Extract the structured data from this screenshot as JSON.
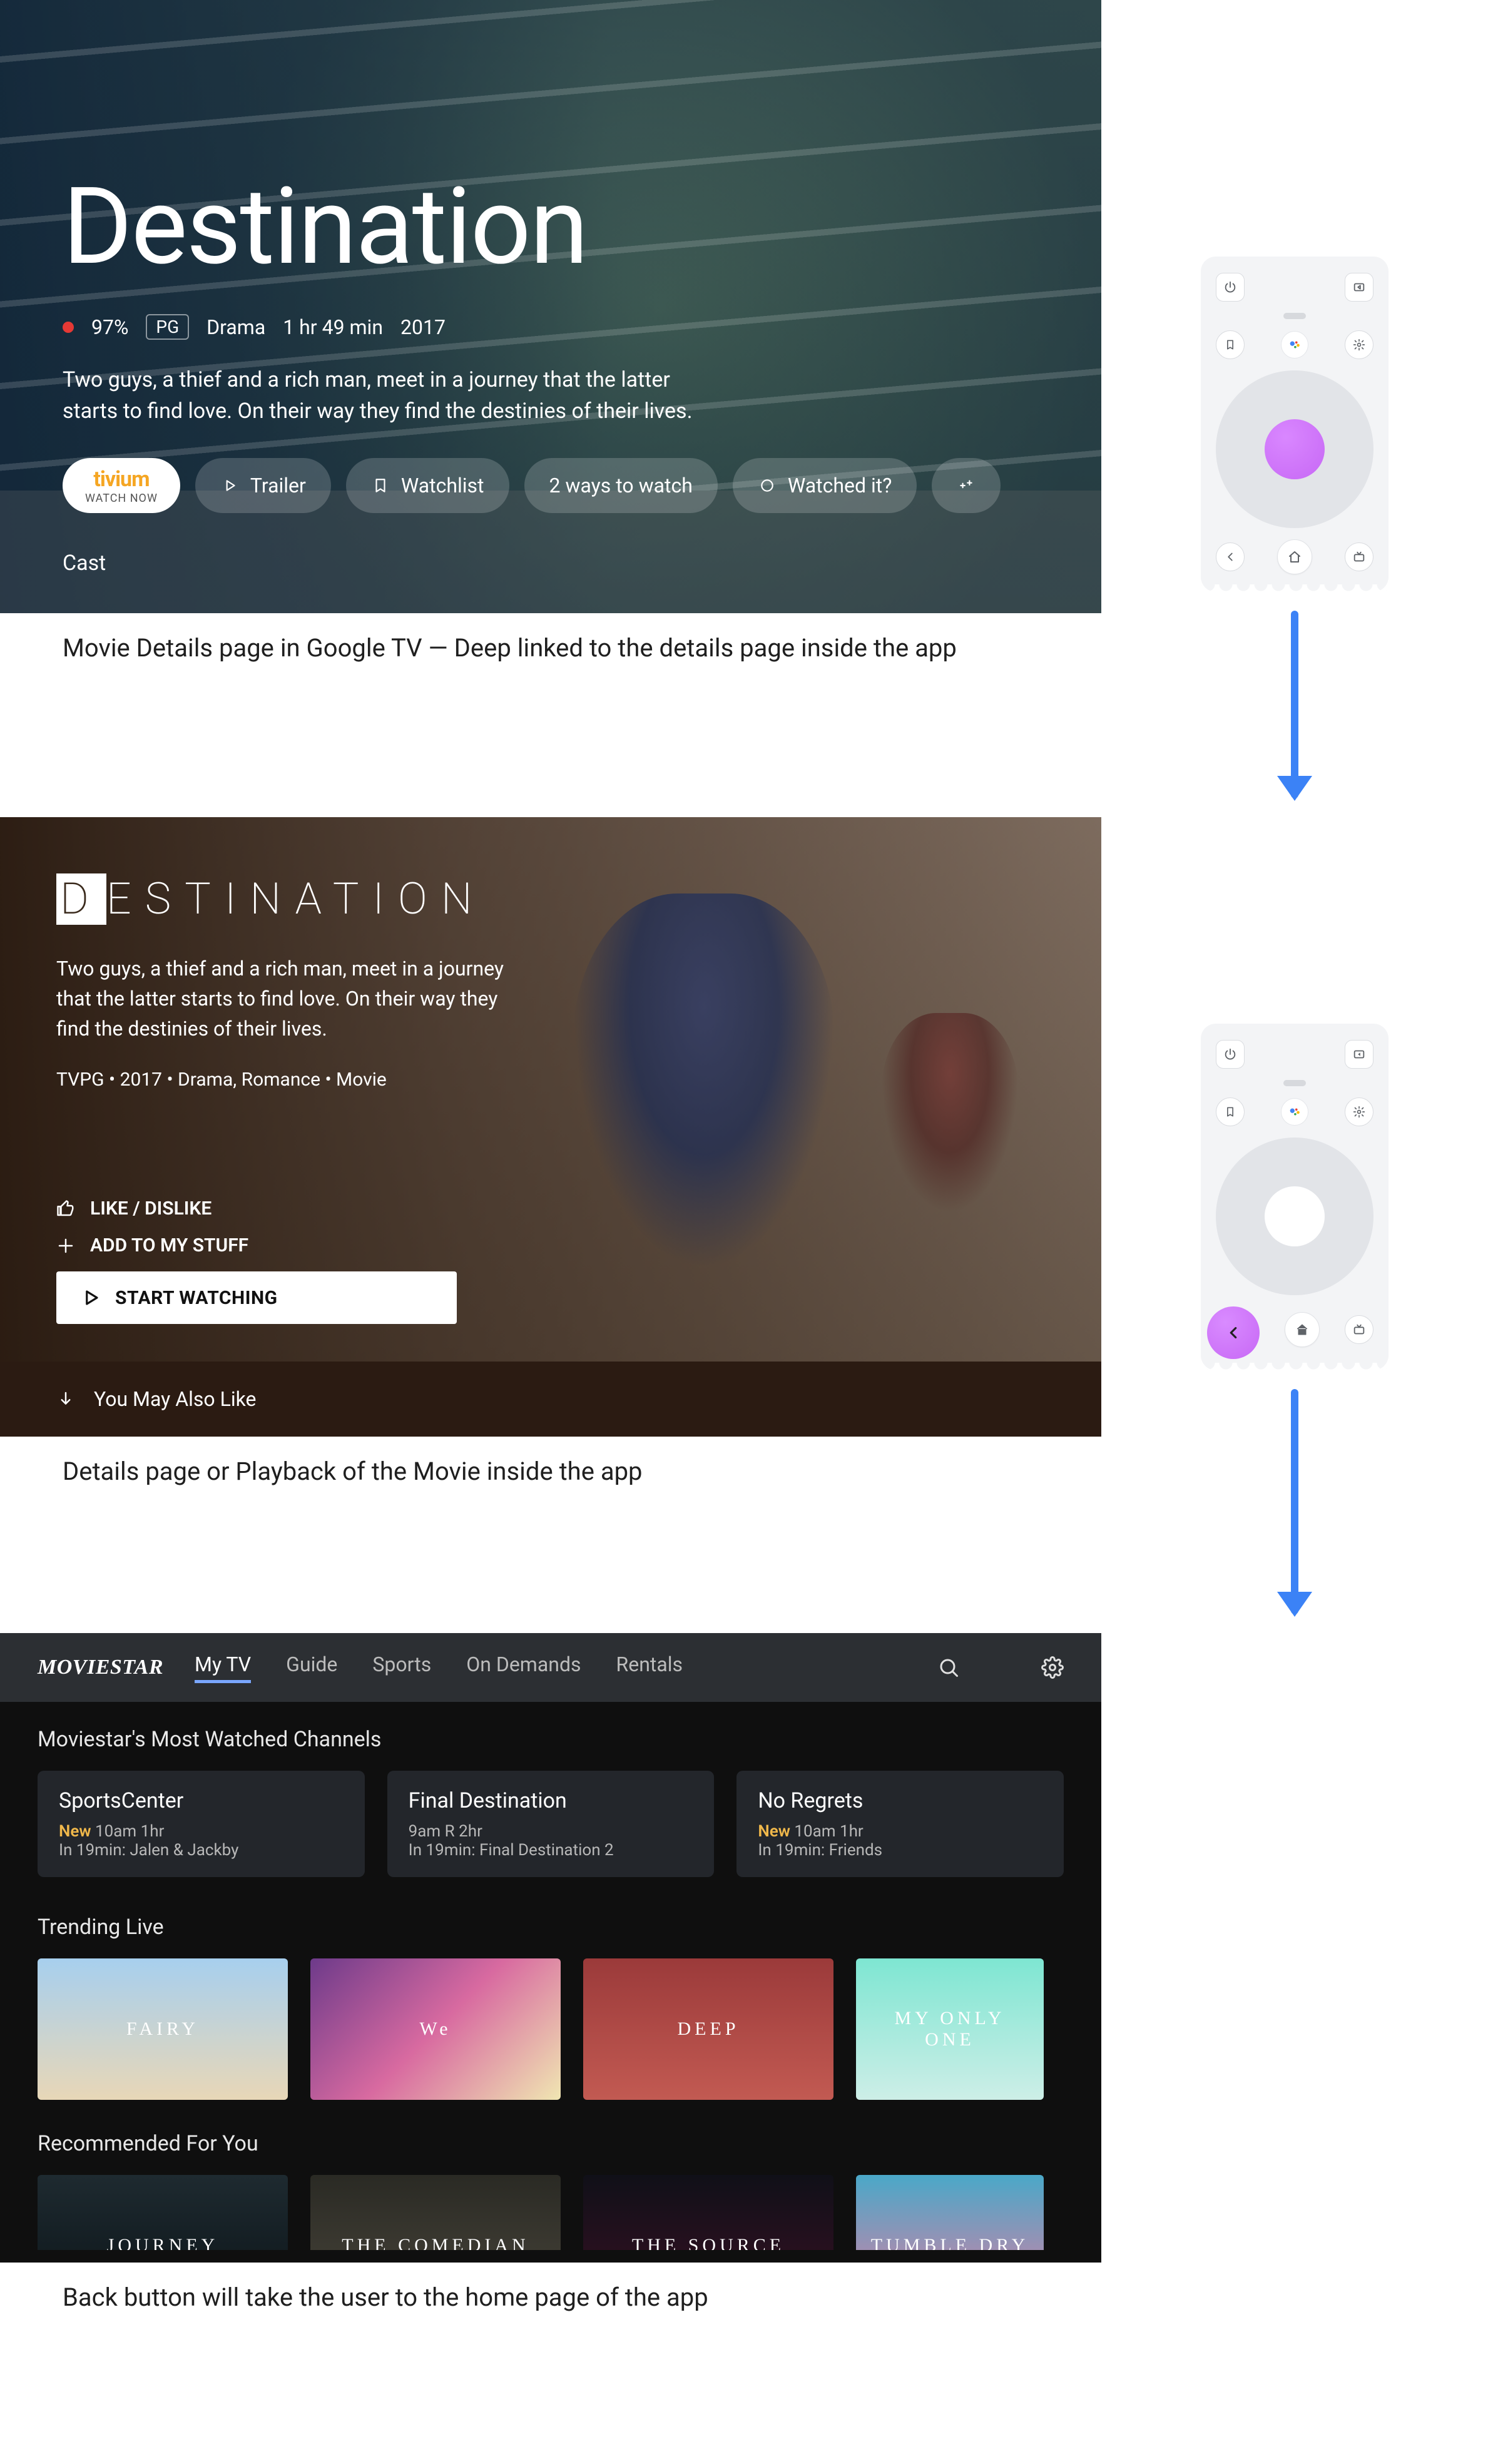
{
  "captions": {
    "a": "Movie Details page in Google TV — Deep linked to the details page inside the app",
    "b": "Details page or Playback of the Movie inside the app",
    "c": "Back button will take the user to the home page of the app"
  },
  "googletv": {
    "title": "Destination",
    "rating_pct": "97%",
    "content_rating": "PG",
    "genre": "Drama",
    "duration": "1 hr 49 min",
    "year": "2017",
    "description": "Two guys, a thief and a rich man, meet in a journey that the latter starts to find love. On their way they find the destinies of their lives.",
    "provider_logo": "tivium",
    "provider_sub": "WATCH NOW",
    "btn_trailer": "Trailer",
    "btn_watchlist": "Watchlist",
    "btn_ways": "2 ways to watch",
    "btn_watched": "Watched it?",
    "cast_label": "Cast"
  },
  "inapp": {
    "title": "DESTINATION",
    "title_first": "D",
    "title_rest": "ESTINATION",
    "description": "Two guys, a thief and a rich man, meet in a journey that the latter starts to find love. On their way they find the destinies of their lives.",
    "meta": "TVPG • 2017 • Drama, Romance • Movie",
    "btn_like": "LIKE / DISLIKE",
    "btn_add": "ADD TO MY STUFF",
    "btn_start": "START WATCHING",
    "you_may": "You May Also Like"
  },
  "home": {
    "brand": "MOVIESTAR",
    "tabs": [
      "My TV",
      "Guide",
      "Sports",
      "On Demands",
      "Rentals"
    ],
    "active_tab": 0,
    "section_channels_title": "Moviestar's Most Watched Channels",
    "channels": [
      {
        "title": "SportsCenter",
        "new": true,
        "time": "10am 1hr",
        "next": "In 19min: Jalen & Jackby"
      },
      {
        "title": "Final Destination",
        "new": false,
        "time": "9am R 2hr",
        "next": "In 19min: Final Destination 2"
      },
      {
        "title": "No Regrets",
        "new": true,
        "time": "10am 1hr",
        "next": "In 19min: Friends"
      }
    ],
    "section_trending_title": "Trending Live",
    "trending": [
      "FAIRY",
      "We",
      "DEEP",
      "MY ONLY ONE"
    ],
    "section_recommended_title": "Recommended For You",
    "recommended": [
      "JOURNEY",
      "THE COMEDIAN",
      "THE SOURCE",
      "TUMBLE DRY"
    ]
  },
  "new_label": "New"
}
